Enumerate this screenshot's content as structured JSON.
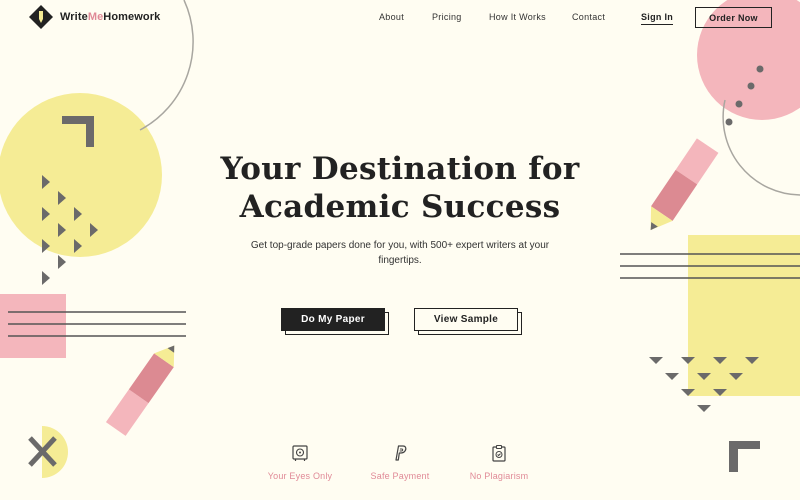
{
  "brand": {
    "name_part1": "Write",
    "name_part2": "Me",
    "name_part3": "Homework"
  },
  "nav": {
    "about": "About",
    "pricing": "Pricing",
    "how": "How It Works",
    "contact": "Contact"
  },
  "header": {
    "signin": "Sign In",
    "order": "Order Now"
  },
  "hero": {
    "title_line1": "Your Destination for",
    "title_line2": "Academic Success",
    "subtitle": "Get top-grade papers done for you, with 500+ expert writers at your fingertips.",
    "primary_cta": "Do My Paper",
    "secondary_cta": "View Sample"
  },
  "features": [
    {
      "label": "Your Eyes Only",
      "icon": "privacy-safe-icon"
    },
    {
      "label": "Safe Payment",
      "icon": "paypal-icon"
    },
    {
      "label": "No Plagiarism",
      "icon": "clipboard-check-icon"
    }
  ],
  "colors": {
    "background": "#fffdf2",
    "yellow": "#f5ec95",
    "pink": "#f4b6bc",
    "dark_pink": "#dc8a92",
    "gray": "#6b6a6a",
    "accent_text": "#e08a97"
  }
}
